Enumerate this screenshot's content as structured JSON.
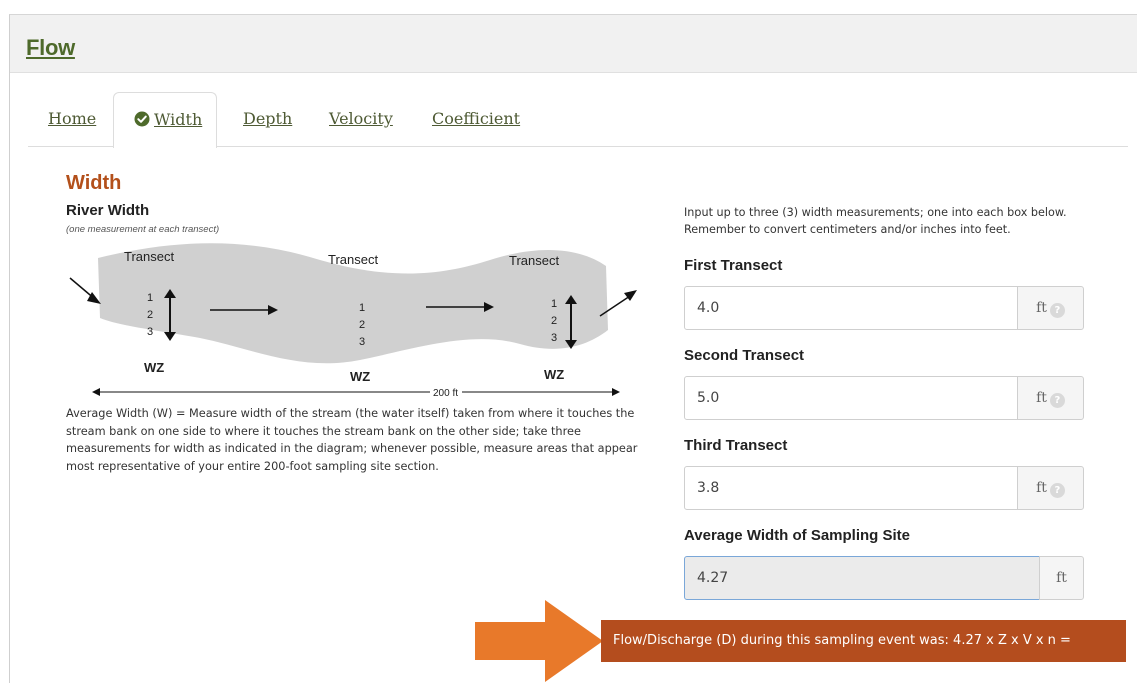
{
  "header": {
    "title": "Flow"
  },
  "tabs": [
    {
      "label": "Home"
    },
    {
      "label": "Width",
      "active": true
    },
    {
      "label": "Depth"
    },
    {
      "label": "Velocity"
    },
    {
      "label": "Coefficient"
    }
  ],
  "section": {
    "title": "Width"
  },
  "diagram": {
    "title": "River Width",
    "subtitle": "(one measurement at each transect)",
    "transects": [
      "Transect",
      "Transect",
      "Transect"
    ],
    "numbers": [
      "1",
      "2",
      "3"
    ],
    "wz_label": "WZ",
    "distance_label": "200 ft"
  },
  "description": "Average Width (W) = Measure width of the stream (the water itself) taken from where it touches the stream bank on one side to where it touches the stream bank on the other side; take three measurements for width as indicated in the diagram; whenever possible, measure areas that appear most representative of your entire 200-foot sampling site section.",
  "instructions": {
    "line1": "Input up to three (3) width measurements; one into each box below.",
    "line2": "Remember to convert centimeters and/or inches into feet."
  },
  "fields": [
    {
      "label": "First Transect",
      "value": "4.0",
      "unit": "ft"
    },
    {
      "label": "Second Transect",
      "value": "5.0",
      "unit": "ft"
    },
    {
      "label": "Third Transect",
      "value": "3.8",
      "unit": "ft"
    }
  ],
  "average": {
    "label": "Average Width of Sampling Site",
    "value": "4.27",
    "unit": "ft"
  },
  "help_glyph": "?",
  "result": {
    "text": "Flow/Discharge (D) during this sampling event was: 4.27 x Z x V x n ="
  },
  "colors": {
    "brand_green": "#4e6a2b",
    "section_orange": "#b3501b",
    "result_bg": "#b44d1e",
    "arrow": "#e8792a"
  },
  "icons": {
    "active_tab": "check-circle-icon",
    "help": "question-circle-icon",
    "callout": "arrow-right-icon"
  }
}
